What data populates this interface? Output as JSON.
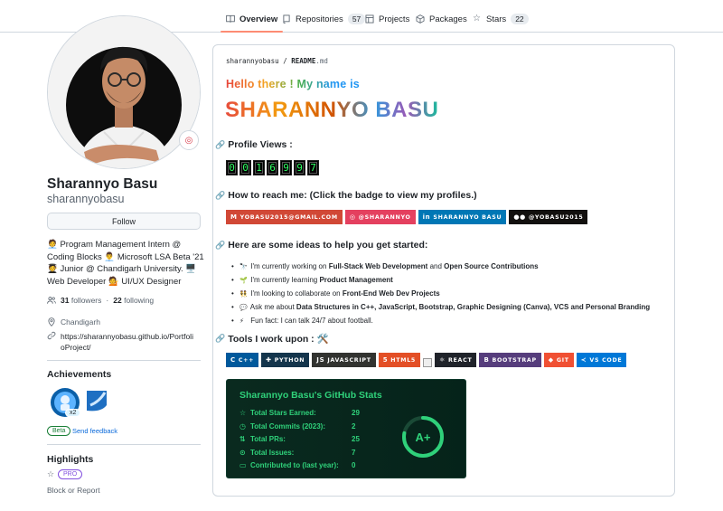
{
  "tabs": [
    {
      "label": "Overview",
      "icon": "book-icon",
      "active": true
    },
    {
      "label": "Repositories",
      "icon": "repo-icon",
      "count": "57"
    },
    {
      "label": "Projects",
      "icon": "table-icon"
    },
    {
      "label": "Packages",
      "icon": "package-icon"
    },
    {
      "label": "Stars",
      "icon": "star-icon",
      "count": "22"
    }
  ],
  "profile": {
    "fullname": "Sharannyo Basu",
    "username": "sharannyobasu",
    "follow_label": "Follow",
    "bio": "🧑‍💼 Program Management Intern @ Coding Blocks 👨‍💼 Microsoft LSA Beta '21 🧑‍🎓 Junior @ Chandigarh University. 🖥️ Web Developer 💁 UI/UX Designer",
    "followers": "31",
    "followers_label": "followers",
    "following": "22",
    "following_label": "following",
    "location": "Chandigarh",
    "website": "https://sharannyobasu.github.io/PortfolioProject/"
  },
  "achievements": {
    "title": "Achievements",
    "multiplier": "x2",
    "beta_label": "Beta",
    "feedback_label": "Send feedback"
  },
  "highlights": {
    "title": "Highlights",
    "pro_label": "PRO",
    "block_label": "Block or Report"
  },
  "readme": {
    "crumb_user": "sharannyobasu",
    "crumb_sep": "/",
    "crumb_file": "README",
    "crumb_ext": ".md",
    "hello": "Hello there ! My name is",
    "bigname": "SHARANNYO BASU",
    "views_heading": "Profile Views :",
    "views_digits": [
      "0",
      "0",
      "1",
      "6",
      "9",
      "9",
      "7"
    ],
    "reach_heading": "How to reach me: (Click the badge to view my profiles.)",
    "reach_badges": [
      {
        "label": "YOBASU2015@GMAIL.COM",
        "icon": "gmail-icon",
        "color": "#d14836"
      },
      {
        "label": "@SHARANNYO",
        "icon": "instagram-icon",
        "color": "#e4405f"
      },
      {
        "label": "SHARANNYO BASU",
        "icon": "linkedin-icon",
        "color": "#0077b5"
      },
      {
        "label": "@YOBASU2015",
        "icon": "medium-icon",
        "color": "#12100e"
      }
    ],
    "ideas_heading": "Here are some ideas to help you get started:",
    "ideas": [
      {
        "emoji": "🔭",
        "pre": "I'm currently working on ",
        "b1": "Full-Stack Web Development",
        "mid": " and ",
        "b2": "Open Source Contributions"
      },
      {
        "emoji": "🌱",
        "pre": "I'm currently learning ",
        "b1": "Product Management",
        "mid": "",
        "b2": ""
      },
      {
        "emoji": "👯",
        "pre": "I'm looking to collaborate on ",
        "b1": "Front-End Web Dev Projects",
        "mid": "",
        "b2": ""
      },
      {
        "emoji": "💬",
        "pre": "Ask me about ",
        "b1": "Data Structures in C++, JavaScript, Bootstrap, Graphic Designing (Canva), VCS and Personal Branding",
        "mid": "",
        "b2": ""
      },
      {
        "emoji": "⚡",
        "pre": "Fun fact: I can talk 24/7 about football.",
        "b1": "",
        "mid": "",
        "b2": ""
      }
    ],
    "tools_heading": "Tools I work upon : 🛠️",
    "tools": [
      {
        "label": "C++",
        "icon": "cpp-icon",
        "color": "#00599c"
      },
      {
        "label": "PYTHON",
        "icon": "python-icon",
        "color": "#14354c"
      },
      {
        "label": "JAVASCRIPT",
        "icon": "javascript-icon",
        "color": "#323330"
      },
      {
        "label": "HTML5",
        "icon": "html5-icon",
        "color": "#e34f26"
      },
      {
        "label": "REACT",
        "icon": "react-icon",
        "color": "#20232a"
      },
      {
        "label": "BOOTSTRAP",
        "icon": "bootstrap-icon",
        "color": "#563d7c"
      },
      {
        "label": "GIT",
        "icon": "git-icon",
        "color": "#f05033"
      },
      {
        "label": "VS CODE",
        "icon": "vscode-icon",
        "color": "#0078d7"
      }
    ]
  },
  "stats": {
    "title": "Sharannyo Basu's GitHub Stats",
    "rows": [
      {
        "label": "Total Stars Earned:",
        "value": "29",
        "icon": "star-icon"
      },
      {
        "label": "Total Commits (2023):",
        "value": "2",
        "icon": "history-icon"
      },
      {
        "label": "Total PRs:",
        "value": "25",
        "icon": "pull-request-icon"
      },
      {
        "label": "Total Issues:",
        "value": "7",
        "icon": "issue-icon"
      },
      {
        "label": "Contributed to (last year):",
        "value": "0",
        "icon": "repo-icon"
      }
    ],
    "grade": "A+",
    "accent": "#2fd17a"
  }
}
